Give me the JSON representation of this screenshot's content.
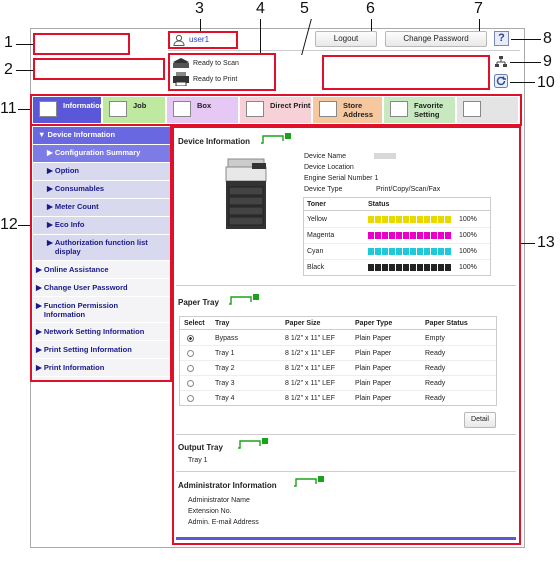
{
  "callouts": [
    "1",
    "2",
    "3",
    "4",
    "5",
    "6",
    "7",
    "8",
    "9",
    "10",
    "11",
    "12",
    "13"
  ],
  "header": {
    "user": "user1",
    "status_scan": "Ready to Scan",
    "status_print": "Ready to Print",
    "logout": "Logout",
    "change_password": "Change Password",
    "help": "?"
  },
  "tabs": [
    {
      "label": "Information",
      "color": "#5a58d8"
    },
    {
      "label": "Job",
      "color": "#bfe8a0"
    },
    {
      "label": "Box",
      "color": "#e6c8f4"
    },
    {
      "label": "Direct Print",
      "color": "#f8d0d8"
    },
    {
      "label": "Store Address",
      "color": "#f6c8a0"
    },
    {
      "label": "Favorite Setting",
      "color": "#c8e8c0"
    },
    {
      "label": "",
      "color": "#e4e4e4"
    }
  ],
  "sidebar": {
    "items": [
      "Device Information",
      "Configuration Summary",
      "Option",
      "Consumables",
      "Meter Count",
      "Eco Info",
      "Authorization function list display",
      "Online Assistance",
      "Change User Password",
      "Function Permission Information",
      "Network Setting Information",
      "Print Setting Information",
      "Print Information"
    ]
  },
  "device": {
    "title": "Device Information",
    "fields": [
      {
        "label": "Device Name",
        "value": ""
      },
      {
        "label": "Device Location",
        "value": ""
      },
      {
        "label": "Engine Serial Number",
        "value": "1"
      },
      {
        "label": "Device Type",
        "value": "Print/Copy/Scan/Fax"
      }
    ],
    "toner_header": [
      "Toner",
      "Status"
    ],
    "toner": [
      {
        "name": "Yellow",
        "color": "#e8d800",
        "pct": "100%"
      },
      {
        "name": "Magenta",
        "color": "#e800c8",
        "pct": "100%"
      },
      {
        "name": "Cyan",
        "color": "#20c8d8",
        "pct": "100%"
      },
      {
        "name": "Black",
        "color": "#222222",
        "pct": "100%"
      }
    ]
  },
  "paper_tray": {
    "title": "Paper Tray",
    "headers": [
      "Select",
      "Tray",
      "Paper Size",
      "Paper Type",
      "Paper Status"
    ],
    "rows": [
      {
        "tray": "Bypass",
        "size": "8 1/2\" x 11\" LEF",
        "type": "Plain Paper",
        "status": "Empty",
        "selected": true
      },
      {
        "tray": "Tray 1",
        "size": "8 1/2\" x 11\" LEF",
        "type": "Plain Paper",
        "status": "Ready",
        "selected": false
      },
      {
        "tray": "Tray 2",
        "size": "8 1/2\" x 11\" LEF",
        "type": "Plain Paper",
        "status": "Ready",
        "selected": false
      },
      {
        "tray": "Tray 3",
        "size": "8 1/2\" x 11\" LEF",
        "type": "Plain Paper",
        "status": "Ready",
        "selected": false
      },
      {
        "tray": "Tray 4",
        "size": "8 1/2\" x 11\" LEF",
        "type": "Plain Paper",
        "status": "Ready",
        "selected": false
      }
    ],
    "detail": "Detail"
  },
  "output_tray": {
    "title": "Output Tray",
    "value": "Tray 1"
  },
  "admin": {
    "title": "Administrator Information",
    "fields": [
      "Administrator Name",
      "Extension No.",
      "Admin. E-mail Address"
    ]
  }
}
